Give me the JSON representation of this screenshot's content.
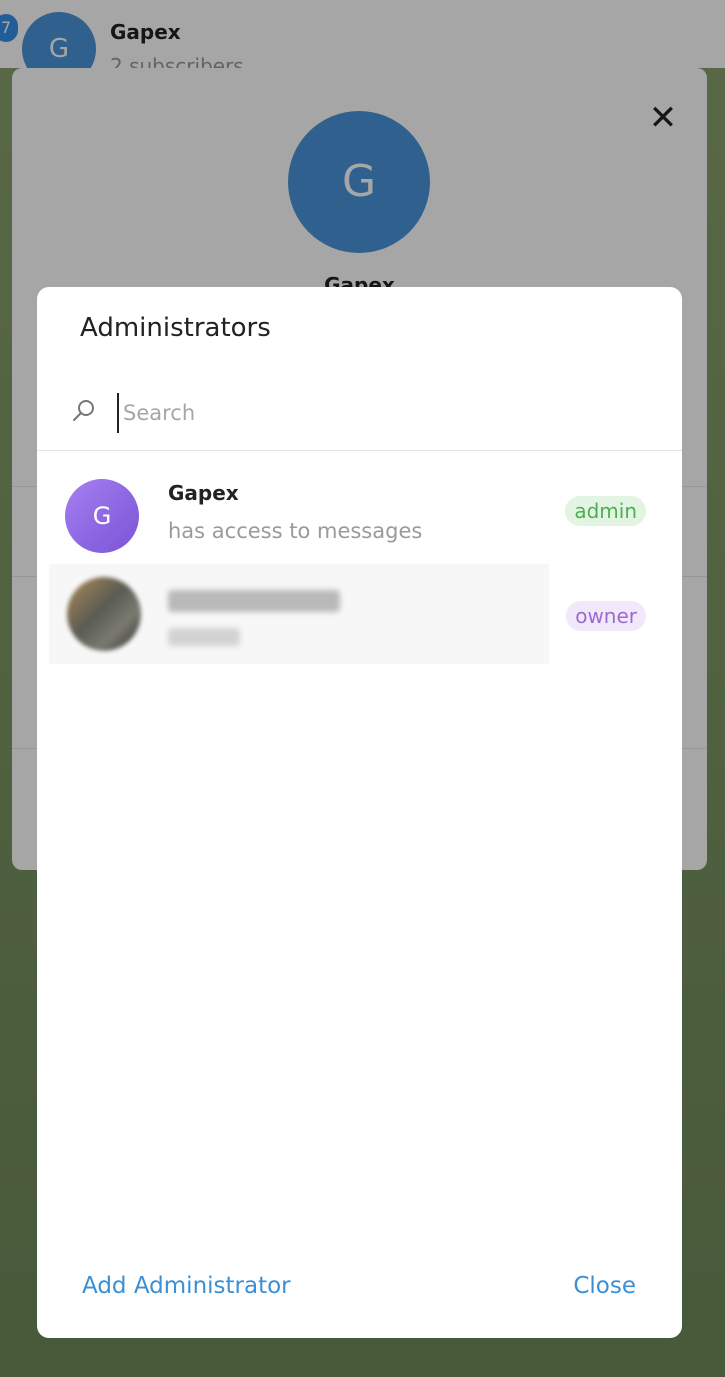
{
  "chat_header": {
    "unread_count": "7",
    "avatar_letter": "G",
    "title": "Gapex",
    "subtitle": "2 subscribers"
  },
  "profile": {
    "avatar_letter": "G",
    "name": "Gapex"
  },
  "dialog": {
    "title": "Administrators",
    "search_placeholder": "Search",
    "admins": [
      {
        "avatar_letter": "G",
        "name": "Gapex",
        "status": "has access to messages",
        "role": "admin",
        "avatar_color": "#8b63e0"
      },
      {
        "avatar_letter": "",
        "name": "",
        "status": "",
        "role": "owner"
      }
    ],
    "add_button": "Add Administrator",
    "close_button": "Close"
  },
  "colors": {
    "accent": "#3a8fd5",
    "admin_badge": "#4caf50",
    "owner_badge": "#9c6ad1"
  }
}
